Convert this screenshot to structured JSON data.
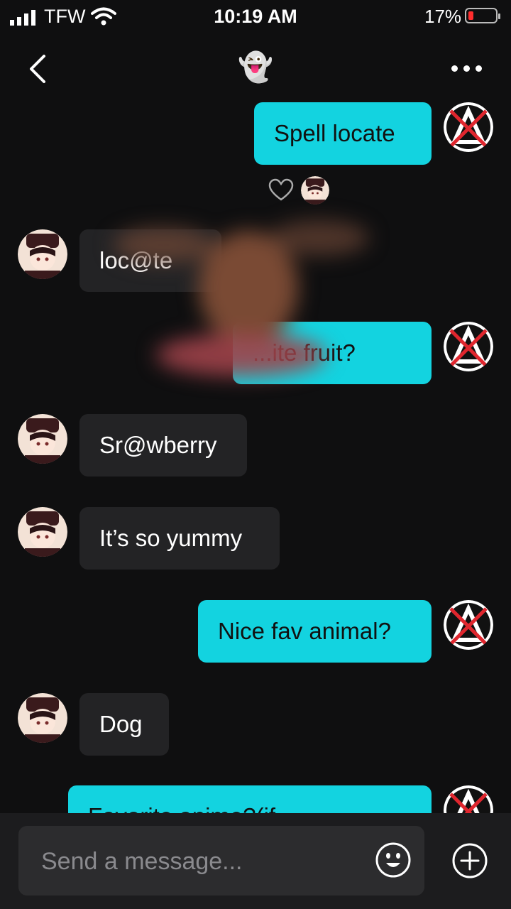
{
  "status": {
    "carrier": "TFW",
    "time": "10:19 AM",
    "battery": "17%"
  },
  "header": {
    "title": "👻"
  },
  "messages": [
    {
      "side": "out",
      "text": "Spell locate"
    },
    {
      "side": "in",
      "text": "loc@te"
    },
    {
      "side": "out",
      "text": "...ite fruit?"
    },
    {
      "side": "in",
      "text": "Sr@wberry"
    },
    {
      "side": "in",
      "text": "It’s so yummy"
    },
    {
      "side": "out",
      "text": "Nice fav animal?"
    },
    {
      "side": "in",
      "text": "Dog"
    },
    {
      "side": "out",
      "text": "Favorite anime?(if ..."
    }
  ],
  "input": {
    "placeholder": "Send a message..."
  },
  "colors": {
    "background": "#0f0f10",
    "outgoing_bubble": "#13d3e0",
    "incoming_bubble": "#232325",
    "battery_low": "#ff2d2d"
  }
}
